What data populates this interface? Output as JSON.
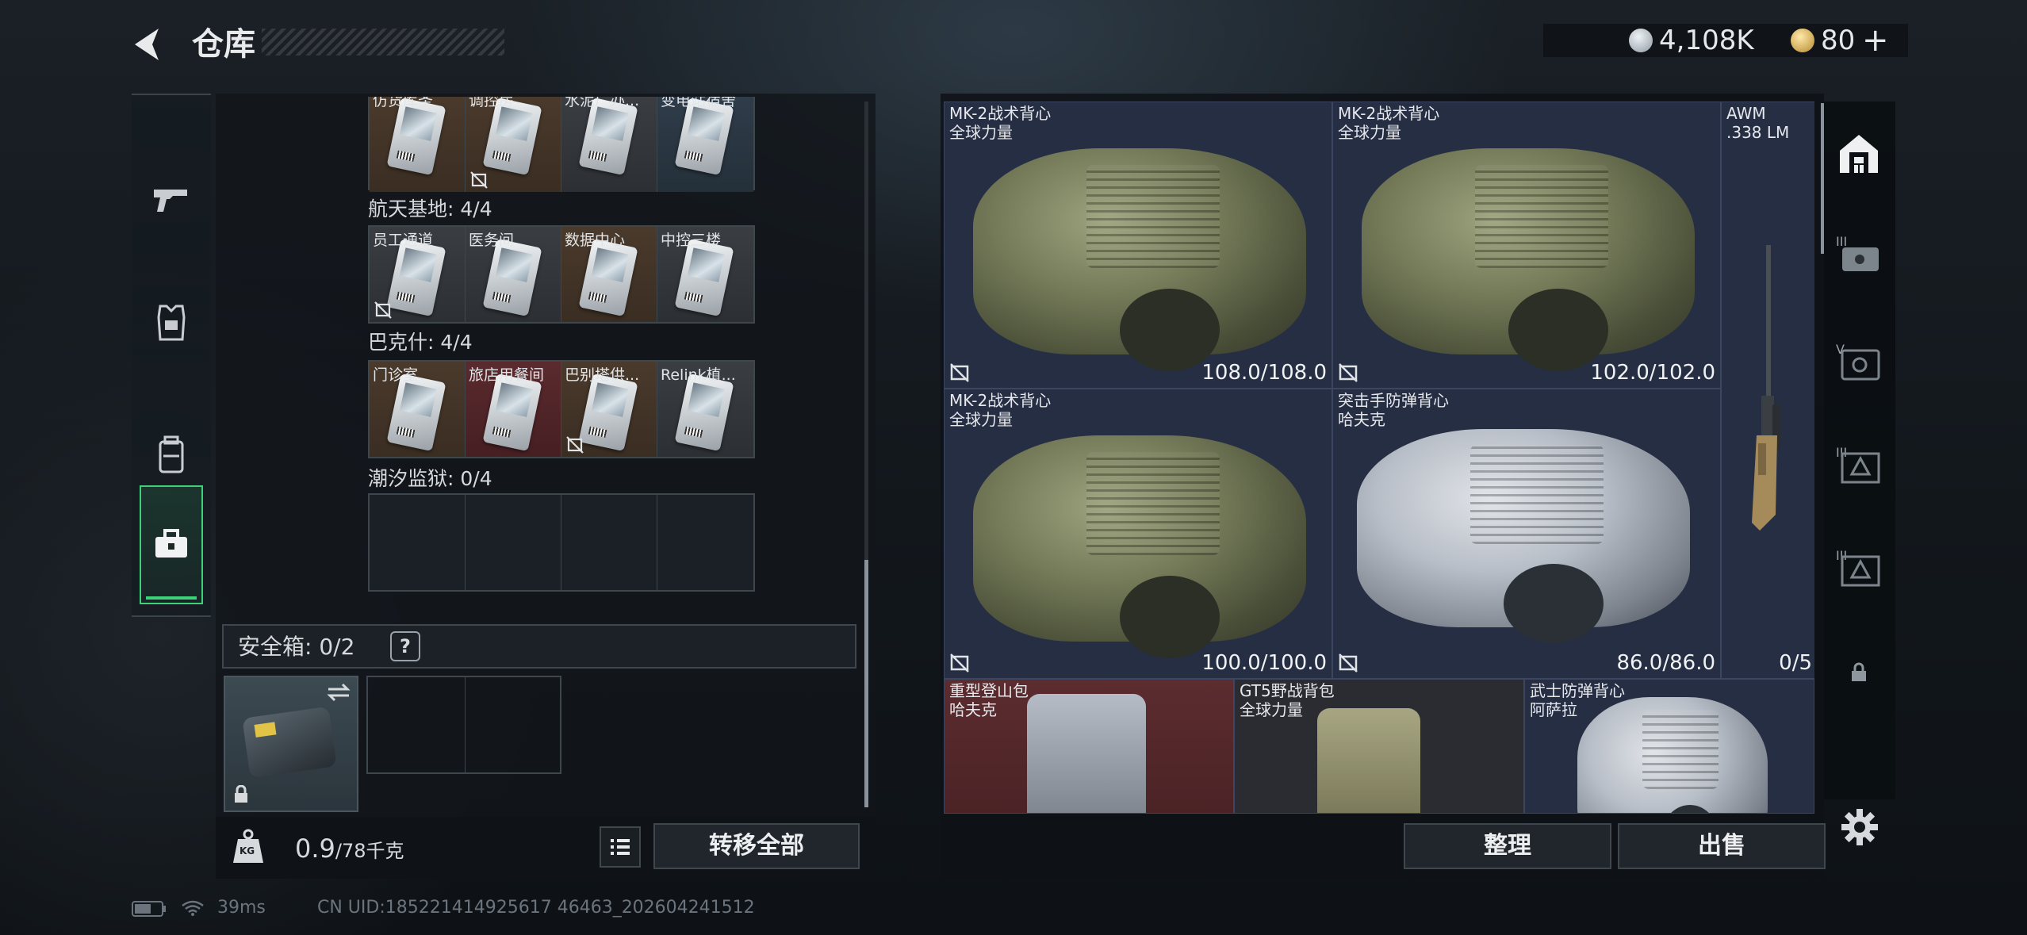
{
  "header": {
    "title": "仓库",
    "currency1": "4,108K",
    "currency2": "80",
    "currency2_plus": "+",
    "coin1_color": "#b9c3cc",
    "coin2_color": "#d7a94b"
  },
  "left_tabs": [
    {
      "icon": "gun-icon"
    },
    {
      "icon": "armor-icon"
    },
    {
      "icon": "backpack-icon"
    },
    {
      "icon": "briefcase-icon",
      "active": true
    }
  ],
  "key_sections": [
    {
      "title": "",
      "cells": [
        {
          "label": "仿货库圣",
          "bg": "brown",
          "no_drop": false
        },
        {
          "label": "调控房",
          "bg": "brown",
          "no_drop": true
        },
        {
          "label": "水泥厂办...",
          "bg": "gray",
          "no_drop": false
        },
        {
          "label": "变电站宿舍",
          "bg": "blue",
          "no_drop": false
        }
      ]
    },
    {
      "title": "航天基地: 4/4",
      "cells": [
        {
          "label": "员工通道",
          "bg": "gray",
          "no_drop": true
        },
        {
          "label": "医务间",
          "bg": "gray",
          "no_drop": false
        },
        {
          "label": "数据中心",
          "bg": "brown",
          "no_drop": false
        },
        {
          "label": "中控三楼",
          "bg": "gray",
          "no_drop": false
        }
      ]
    },
    {
      "title": "巴克什: 4/4",
      "cells": [
        {
          "label": "门诊室",
          "bg": "brown",
          "no_drop": false
        },
        {
          "label": "旅店用餐间",
          "bg": "red",
          "no_drop": false
        },
        {
          "label": "巴别塔供...",
          "bg": "brown",
          "no_drop": true
        },
        {
          "label": "Relink植...",
          "bg": "gray",
          "no_drop": false
        }
      ]
    },
    {
      "title": "潮汐监狱: 0/4",
      "cells": [
        {
          "label": "",
          "bg": "dark",
          "no_drop": false
        },
        {
          "label": "",
          "bg": "dark",
          "no_drop": false
        },
        {
          "label": "",
          "bg": "dark",
          "no_drop": false
        },
        {
          "label": "",
          "bg": "dark",
          "no_drop": false
        }
      ]
    }
  ],
  "safebox": {
    "label": "安全箱: 0/2",
    "help": "?"
  },
  "bottom_left": {
    "weight_value": "0.9",
    "weight_cap": "/78千克",
    "kg_label": "KG",
    "move_all": "转移全部"
  },
  "items": [
    {
      "name1": "MK-2战术背心",
      "name2": "全球力量",
      "durability": "108.0/108.0",
      "kind": "vest-green"
    },
    {
      "name1": "MK-2战术背心",
      "name2": "全球力量",
      "durability": "102.0/102.0",
      "kind": "vest-green"
    },
    {
      "name1": "AWM",
      "name2": ".338 LM",
      "durability": "0/5",
      "kind": "rifle"
    },
    {
      "name1": "MK-2战术背心",
      "name2": "全球力量",
      "durability": "100.0/100.0",
      "kind": "vest-green"
    },
    {
      "name1": "突击手防弹背心",
      "name2": "哈夫克",
      "durability": "86.0/86.0",
      "kind": "vest-white"
    },
    {
      "name1": "重型登山包",
      "name2": "哈夫克",
      "durability": "",
      "kind": "pack-gray"
    },
    {
      "name1": "GT5野战背包",
      "name2": "全球力量",
      "durability": "",
      "kind": "pack-green"
    },
    {
      "name1": "武士防弹背心",
      "name2": "阿萨拉",
      "durability": "",
      "kind": "vest-white"
    }
  ],
  "right_tabs": [
    "house-icon",
    "tier3-case-icon",
    "tier5-case-icon",
    "tier3-box-icon",
    "tier3-box2-icon",
    "lock-icon"
  ],
  "bottom_right": {
    "sort": "整理",
    "sell": "出售"
  },
  "status": {
    "ping": "39ms",
    "uid": "CN UID:185221414925617 46463_202604241512"
  }
}
